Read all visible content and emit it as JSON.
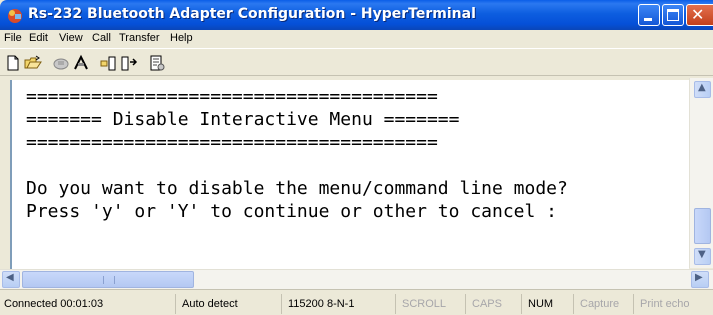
{
  "window": {
    "title": "Rs-232 Bluetooth Adapter Configuration - HyperTerminal"
  },
  "menubar": {
    "items": [
      "File",
      "Edit",
      "View",
      "Call",
      "Transfer",
      "Help"
    ]
  },
  "toolbar": {
    "icons": [
      "new-icon",
      "open-icon",
      "connect-icon",
      "disconnect-icon",
      "send-icon",
      "receive-icon",
      "properties-icon"
    ]
  },
  "terminal": {
    "lines": [
      "======================================",
      "======= Disable Interactive Menu =======",
      "======================================",
      "",
      "Do you want to disable the menu/command line mode?",
      "Press 'y' or 'Y' to continue or other to cancel :"
    ]
  },
  "statusbar": {
    "connected": "Connected 00:01:03",
    "detect": "Auto detect",
    "port": "115200 8-N-1",
    "scroll": "SCROLL",
    "caps": "CAPS",
    "num": "NUM",
    "capture": "Capture",
    "print": "Print echo"
  },
  "colors": {
    "titlebar": "#0550d8",
    "close_button": "#c2401c",
    "frame": "#ece9d8"
  }
}
